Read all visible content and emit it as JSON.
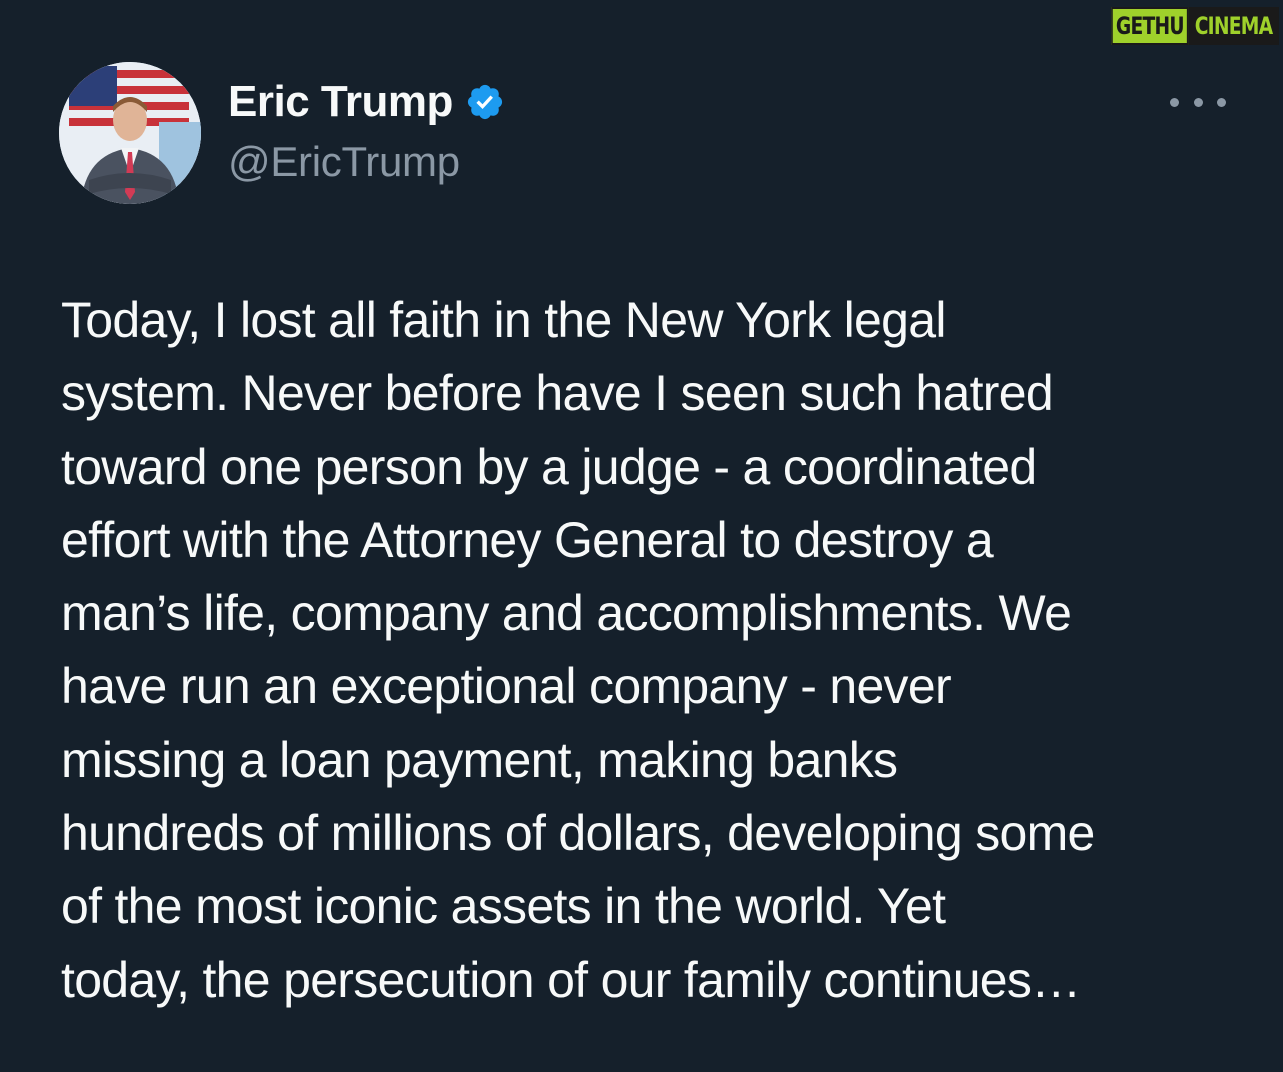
{
  "watermark": {
    "part1": "GETHU",
    "part2": "CINEMA"
  },
  "author": {
    "display_name": "Eric Trump",
    "handle": "@EricTrump",
    "verified": true
  },
  "icons": {
    "verified": "verified-badge-icon",
    "more": "more-options-icon"
  },
  "colors": {
    "background": "#15202b",
    "text": "#f7f9f9",
    "secondary_text": "#8b98a5",
    "verified": "#1d9bf0",
    "watermark_green": "#9fd12b"
  },
  "tweet": {
    "text": "Today, I lost all faith in the New York legal\nsystem. Never before have I seen such hatred\ntoward one person by a judge - a coordinated\neffort with the Attorney General to destroy a\nman’s life, company and accomplishments. We\nhave run an exceptional company - never\nmissing a loan payment, making banks\nhundreds of millions of dollars, developing some\nof the most iconic assets in the world. Yet\ntoday, the persecution of our family continues…"
  }
}
